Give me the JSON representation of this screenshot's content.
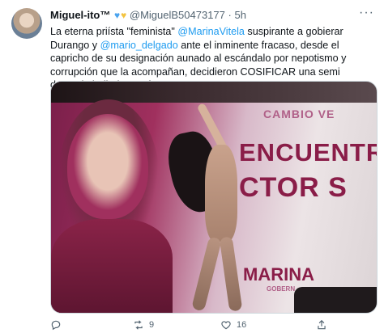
{
  "tweet": {
    "display_name": "Miguel-ito™",
    "handle": "@MiguelB50473177",
    "separator": "·",
    "time": "5h",
    "text_parts": {
      "p1": "La eterna priísta \"feminista\" ",
      "m1": "@MarinaVitela",
      "p2": " suspirante a gobierar Durango y ",
      "m2": "@mario_delgado",
      "p3": " ante el inminente fracaso, desde el capricho de su designación aunado al escándalo por nepotismo y corrupción que la acompañan, decidieron COSIFICAR una semi desnuda bailarina. Así como?"
    }
  },
  "media": {
    "sign_line1": "CAMBIO VE",
    "sign_line2": "ENCUENTRO",
    "sign_line3": "CTOR S",
    "sign_line4": "MARINA",
    "sign_line5": "GOBERN"
  },
  "actions": {
    "reply_count": "",
    "retweet_count": "9",
    "like_count": "16"
  },
  "icons": {
    "reply": "reply-icon",
    "retweet": "retweet-icon",
    "like": "heart-icon",
    "share": "share-icon",
    "more": "more-icon"
  },
  "colors": {
    "accent": "#1d9bf0",
    "muted": "#536471",
    "text": "#0f1419"
  }
}
